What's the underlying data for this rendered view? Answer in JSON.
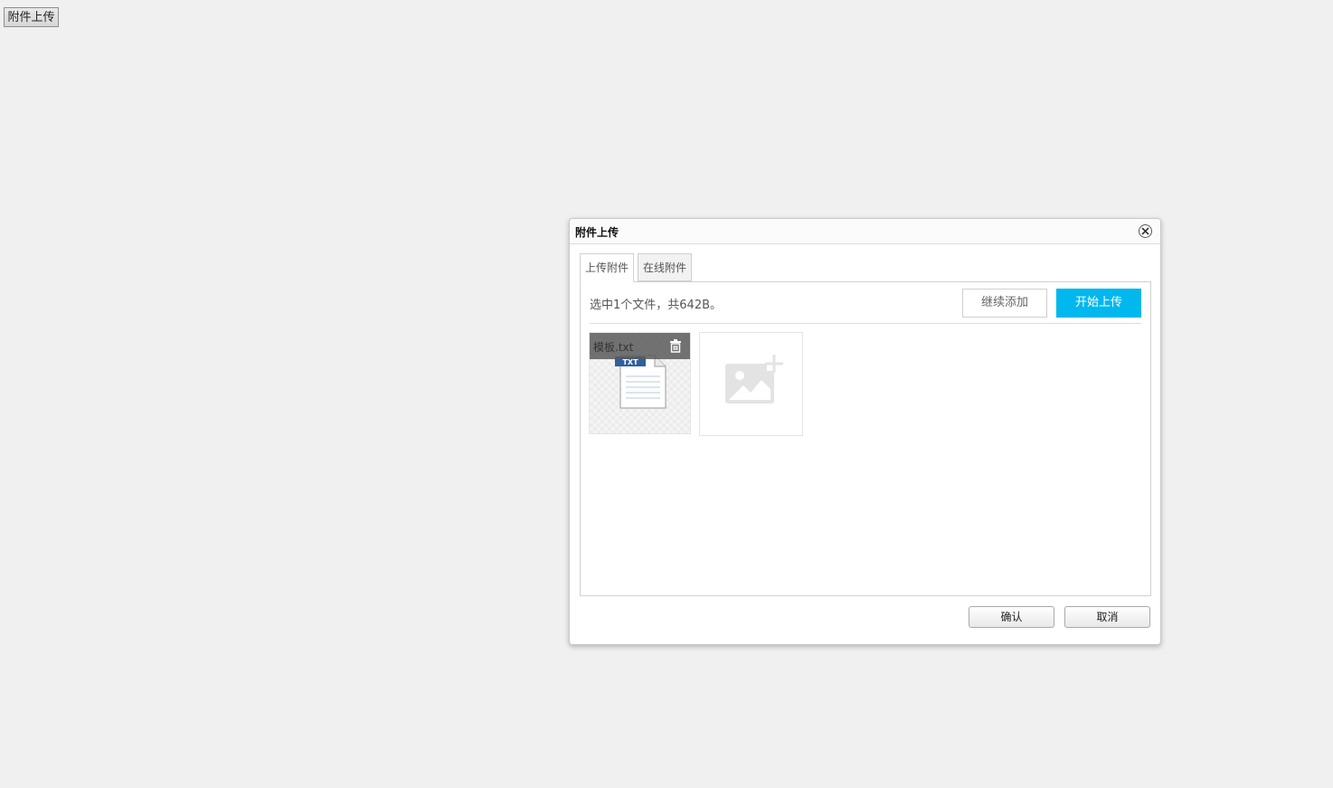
{
  "page": {
    "trigger_button_label": "附件上传"
  },
  "dialog": {
    "title": "附件上传",
    "tabs": [
      {
        "label": "上传附件",
        "active": true
      },
      {
        "label": "在线附件",
        "active": false
      }
    ],
    "status_text": "选中1个文件，共642B。",
    "buttons": {
      "add_more": "继续添加",
      "start_upload": "开始上传",
      "confirm": "确认",
      "cancel": "取消"
    },
    "files": [
      {
        "name": "模板.txt",
        "type_badge": "TXT"
      }
    ],
    "icons": {
      "close": "close-icon",
      "delete": "trash-icon",
      "file": "txt-file-icon",
      "add": "add-image-icon"
    },
    "colors": {
      "primary": "#00b7ee",
      "badge": "#2f5f9f"
    }
  }
}
